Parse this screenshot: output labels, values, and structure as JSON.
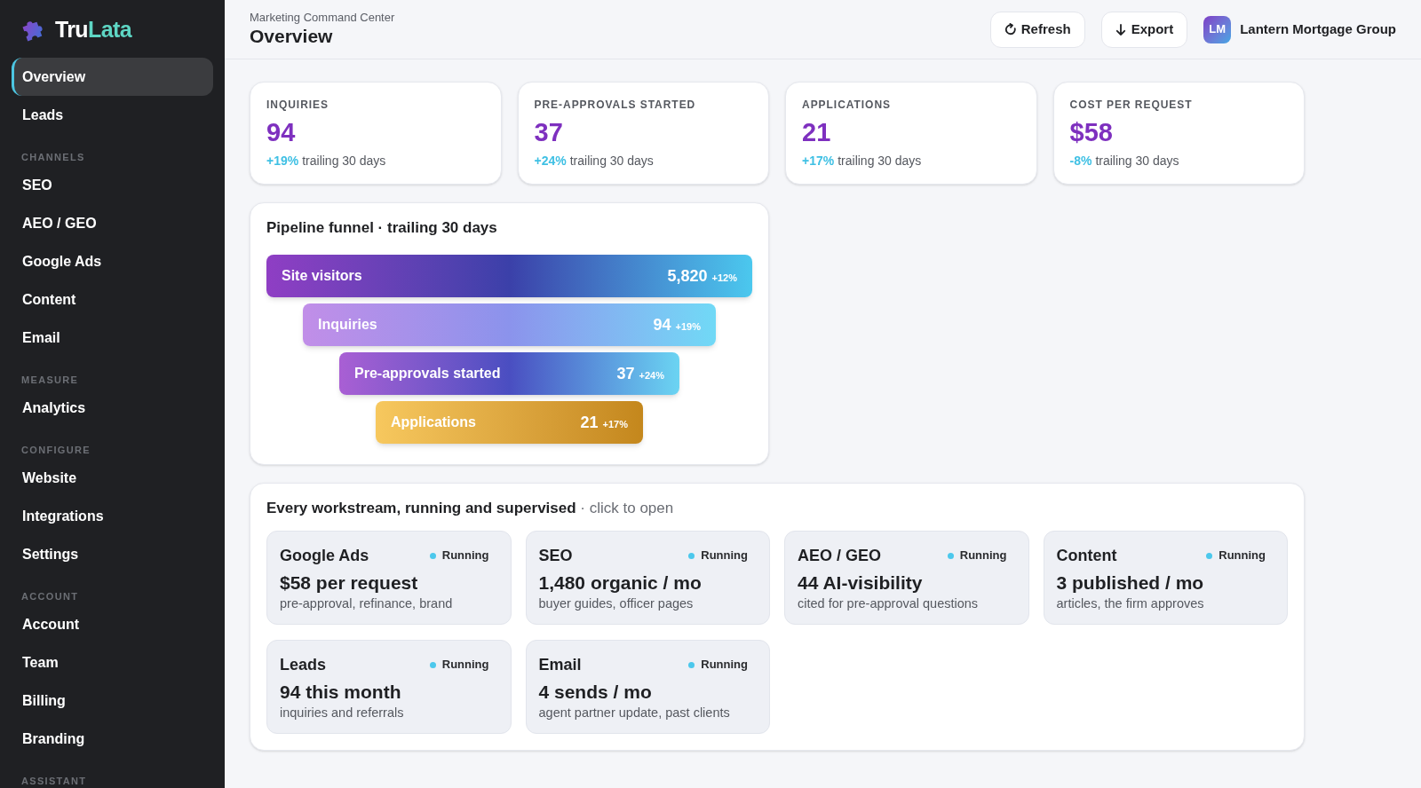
{
  "sidebar": {
    "brand": {
      "name_start": "Tru",
      "name_end": "Lata"
    },
    "groups": [
      {
        "items": [
          {
            "label": "Overview",
            "selected": true
          },
          {
            "label": "Leads",
            "selected": false
          }
        ]
      },
      {
        "heading": "CHANNELS",
        "items": [
          {
            "label": "SEO",
            "selected": false
          },
          {
            "label": "AEO / GEO",
            "selected": false
          },
          {
            "label": "Google Ads",
            "selected": false
          },
          {
            "label": "Content",
            "selected": false
          },
          {
            "label": "Email",
            "selected": false
          }
        ]
      },
      {
        "heading": "MEASURE",
        "items": [
          {
            "label": "Analytics",
            "selected": false
          }
        ]
      },
      {
        "heading": "CONFIGURE",
        "items": [
          {
            "label": "Website",
            "selected": false
          },
          {
            "label": "Integrations",
            "selected": false
          },
          {
            "label": "Settings",
            "selected": false
          }
        ]
      },
      {
        "heading": "ACCOUNT",
        "items": [
          {
            "label": "Account",
            "selected": false
          },
          {
            "label": "Team",
            "selected": false
          },
          {
            "label": "Billing",
            "selected": false
          },
          {
            "label": "Branding",
            "selected": false
          }
        ]
      },
      {
        "heading": "ASSISTANT"
      }
    ]
  },
  "header": {
    "subtitle": "Marketing Command Center",
    "title": "Overview",
    "buttons": [
      {
        "label": "Refresh",
        "kind": "refresh"
      },
      {
        "label": "Export",
        "kind": "export"
      }
    ],
    "account": {
      "initials": "LM",
      "name": "Lantern Mortgage Group"
    }
  },
  "kpis": [
    {
      "label": "INQUIRIES",
      "value": "94",
      "change": "+19%",
      "period": "trailing 30 days"
    },
    {
      "label": "PRE-APPROVALS STARTED",
      "value": "37",
      "change": "+24%",
      "period": "trailing 30 days"
    },
    {
      "label": "APPLICATIONS",
      "value": "21",
      "change": "+17%",
      "period": "trailing 30 days"
    },
    {
      "label": "COST PER REQUEST",
      "value": "$58",
      "change": "-8%",
      "period": "trailing 30 days"
    }
  ],
  "funnel": {
    "title": "Pipeline funnel · trailing 30 days",
    "stages": [
      {
        "label": "Site visitors",
        "value": "5,820",
        "change": "+12%",
        "kind": "deep"
      },
      {
        "label": "Inquiries",
        "value": "94",
        "change": "+19%",
        "kind": "light"
      },
      {
        "label": "Pre-approvals started",
        "value": "37",
        "change": "+24%",
        "kind": "mid"
      },
      {
        "label": "Applications",
        "value": "21",
        "change": "+17%",
        "kind": "gold"
      }
    ]
  },
  "workstreams": {
    "title": "**Every workstream, running and supervised** · click to open",
    "cards": [
      {
        "name": "Google Ads",
        "status": "Running",
        "metric": "$58 per request",
        "detail": "pre-approval, refinance, brand"
      },
      {
        "name": "SEO",
        "status": "Running",
        "metric": "1,480 organic / mo",
        "detail": "buyer guides, officer pages"
      },
      {
        "name": "AEO / GEO",
        "status": "Running",
        "metric": "44 AI-visibility",
        "detail": "cited for pre-approval questions"
      },
      {
        "name": "Content",
        "status": "Running",
        "metric": "3 published / mo",
        "detail": "articles, the firm approves"
      },
      {
        "name": "Leads",
        "status": "Running",
        "metric": "94 this month",
        "detail": "inquiries and referrals"
      },
      {
        "name": "Email",
        "status": "Running",
        "metric": "4 sends / mo",
        "detail": "agent partner update, past clients"
      }
    ]
  }
}
